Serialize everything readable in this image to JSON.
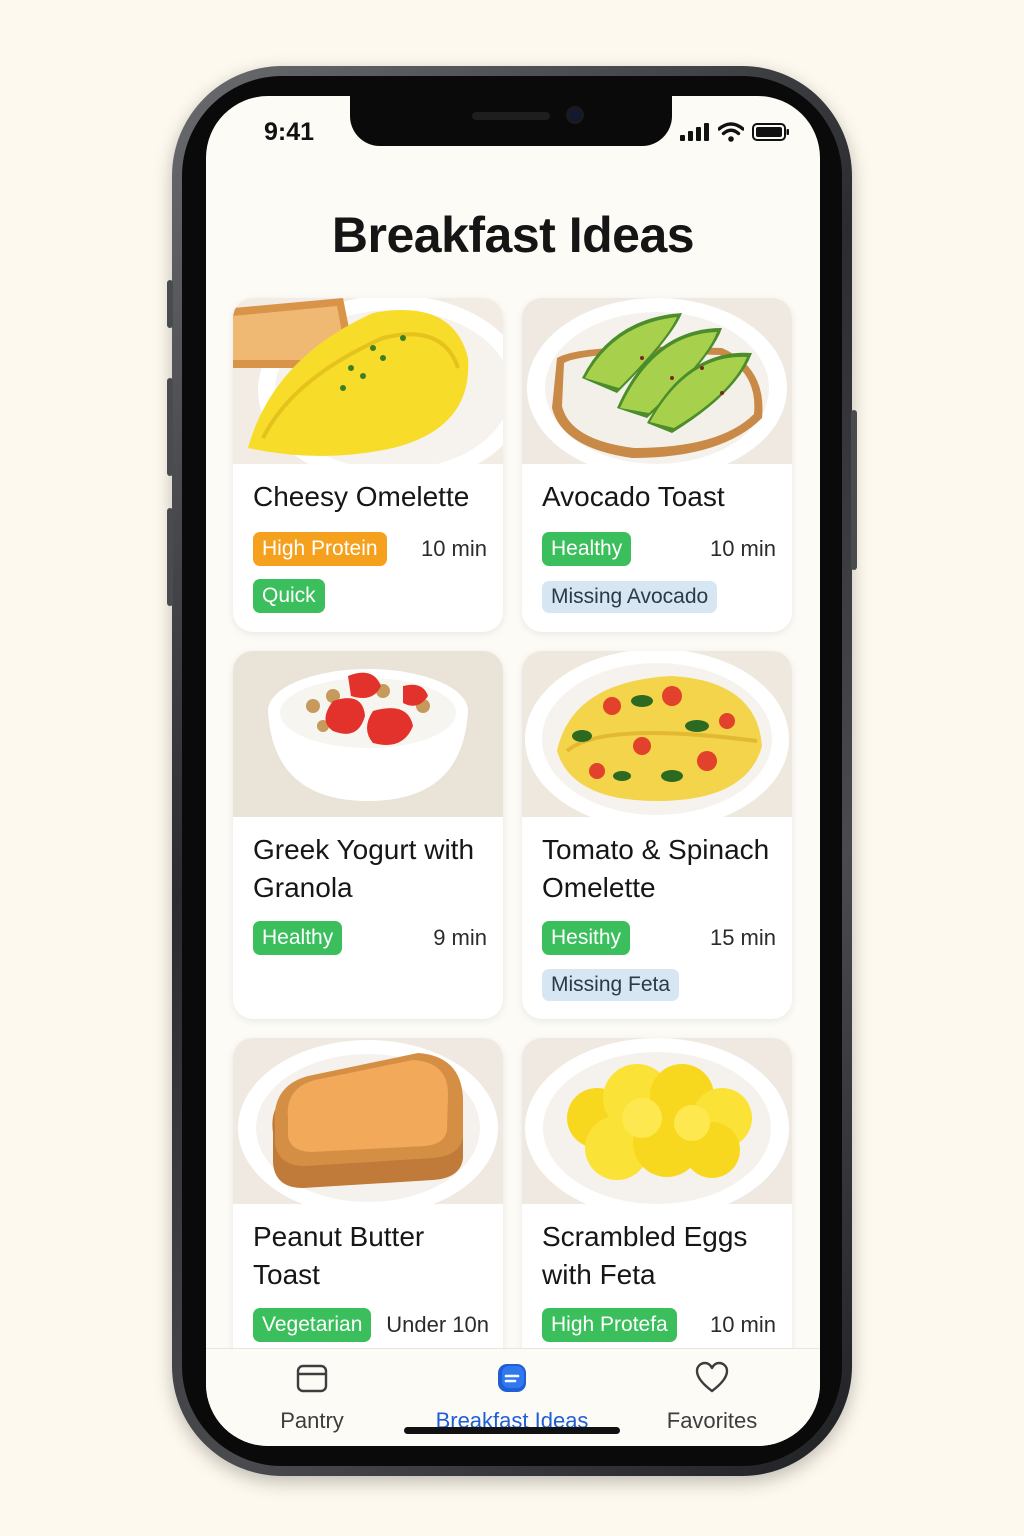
{
  "status": {
    "time": "9:41"
  },
  "page": {
    "title": "Breakfast Ideas"
  },
  "recipes": [
    {
      "title": "Cheesy Omelette",
      "tags": [
        "High Protein",
        "Quick"
      ],
      "time": "10 min"
    },
    {
      "title": "Avocado Toast",
      "tags": [
        "Healthy"
      ],
      "missing": "Missing Avocado",
      "time": "10 min"
    },
    {
      "title": "Greek Yogurt with Granola",
      "tags": [
        "Healthy"
      ],
      "time": "9 min"
    },
    {
      "title": "Tomato & Spinach Omelette",
      "tags": [
        "Hesithy"
      ],
      "missing": "Missing Feta",
      "time": "15 min"
    },
    {
      "title": "Peanut Butter Toast",
      "tags": [
        "Vegetarian"
      ],
      "time": "Under 10n"
    },
    {
      "title": "Scrambled Eggs with Feta",
      "tags": [
        "High Protefa"
      ],
      "time": "10 min"
    }
  ],
  "tabs": [
    {
      "label": "Pantry",
      "icon": "pantry-icon"
    },
    {
      "label": "Breakfast Ideas",
      "icon": "breakfast-ideas-icon",
      "active": true
    },
    {
      "label": "Favorites",
      "icon": "heart-icon"
    }
  ],
  "colors": {
    "tag_green": "#3bbf5c",
    "tag_orange": "#f6a11d",
    "tag_missing": "#d6e6f2",
    "active_tab": "#1f5fd6",
    "background": "#fdf9ee"
  }
}
